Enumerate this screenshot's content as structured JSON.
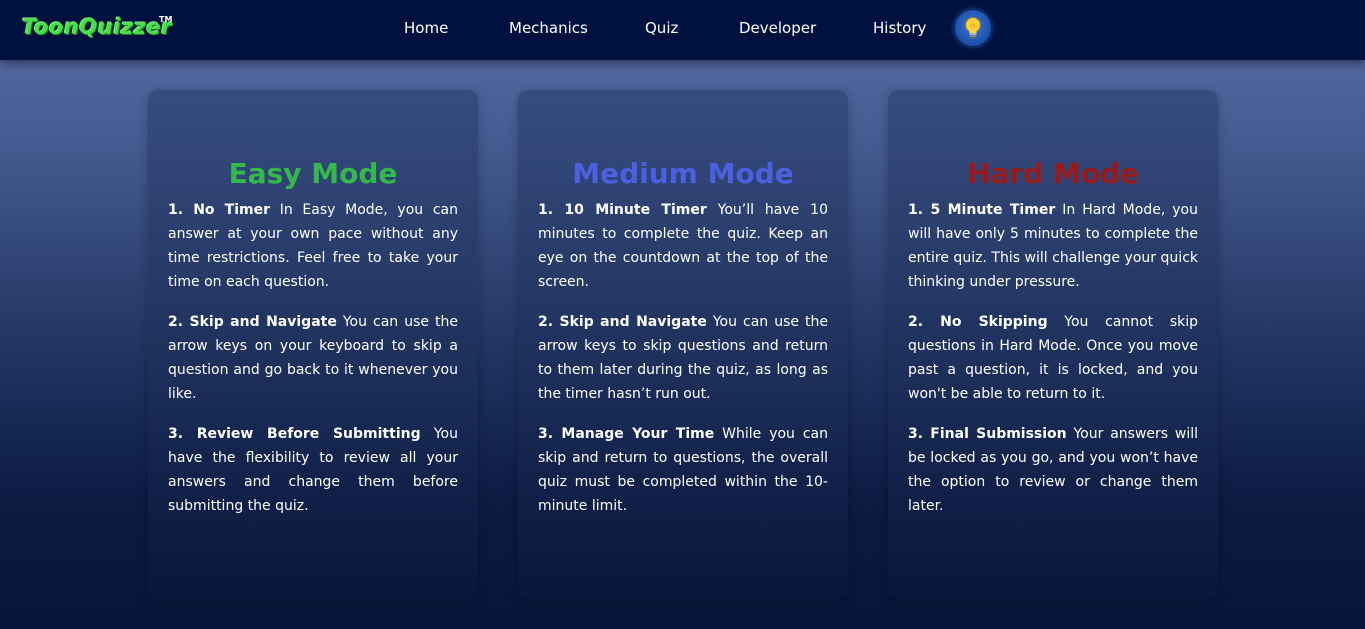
{
  "nav": {
    "logo": "ToonQuizzer",
    "logo_tm": "TM",
    "links": [
      "Home",
      "Mechanics",
      "Quiz",
      "Developer",
      "History"
    ],
    "theme_icon": "lightbulb-icon"
  },
  "cards": [
    {
      "title": "Easy Mode",
      "title_color": "#33b84a",
      "items": [
        {
          "heading": "1. No Timer",
          "text": " In Easy Mode, you can answer at your own pace without any time restrictions. Feel free to take your time on each question."
        },
        {
          "heading": "2. Skip and Navigate",
          "text": " You can use the arrow keys on your keyboard to skip a question and go back to it whenever you like."
        },
        {
          "heading": "3. Review Before Submitting",
          "text": " You have the flexibility to review all your answers and change them before submitting the quiz."
        }
      ]
    },
    {
      "title": "Medium Mode",
      "title_color": "#4a60e0",
      "items": [
        {
          "heading": "1. 10 Minute Timer",
          "text": " You’ll have 10 minutes to complete the quiz. Keep an eye on the countdown at the top of the screen."
        },
        {
          "heading": "2. Skip and Navigate",
          "text": " You can use the arrow keys to skip questions and return to them later during the quiz, as long as the timer hasn’t run out."
        },
        {
          "heading": "3. Manage Your Time",
          "text": " While you can skip and return to questions, the overall quiz must be completed within the 10-minute limit."
        }
      ]
    },
    {
      "title": "Hard Mode",
      "title_color": "#9a1a1a",
      "items": [
        {
          "heading": "1. 5 Minute Timer",
          "text": " In Hard Mode, you will have only 5 minutes to complete the entire quiz. This will challenge your quick thinking under pressure."
        },
        {
          "heading": "2. No Skipping",
          "text": " You cannot skip questions in Hard Mode. Once you move past a question, it is locked, and you won't be able to return to it."
        },
        {
          "heading": "3. Final Submission",
          "text": " Your answers will be locked as you go, and you won’t have the option to review or change them later."
        }
      ]
    }
  ]
}
